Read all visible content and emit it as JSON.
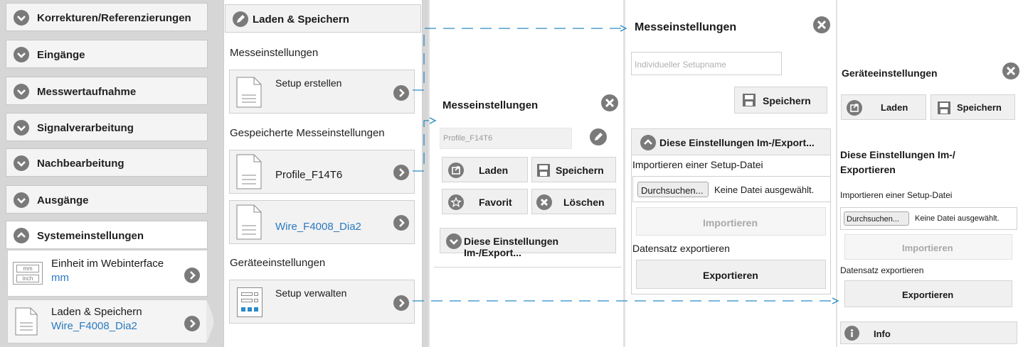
{
  "nav": {
    "items": [
      {
        "label": "Korrekturen/Referenzierungen"
      },
      {
        "label": "Eingänge"
      },
      {
        "label": "Messwertaufnahme"
      },
      {
        "label": "Signalverarbeitung"
      },
      {
        "label": "Nachbearbeitung"
      },
      {
        "label": "Ausgänge"
      },
      {
        "label": "Systemeinstellungen"
      }
    ],
    "unit_item": {
      "label": "Einheit im Webinterface",
      "value": "mm",
      "icon_top": "mm",
      "icon_bottom": "inch"
    },
    "save_item": {
      "label": "Laden & Speichern",
      "value": "Wire_F4008_Dia2"
    }
  },
  "panel2": {
    "title": "Laden & Speichern",
    "section1": "Messeinstellungen",
    "setup_create": "Setup erstellen",
    "section2": "Gespeicherte Messeinstellungen",
    "profile1": "Profile_F14T6",
    "profile2": "Wire_F4008_Dia2",
    "section3": "Geräteeinstellungen",
    "setup_manage": "Setup verwalten"
  },
  "panel3": {
    "title": "Messeinstellungen",
    "name_value": "Profile_F14T6",
    "load": "Laden",
    "save": "Speichern",
    "favorite": "Favorit",
    "delete": "Löschen",
    "export_header": "Diese Einstellungen Im-/Export..."
  },
  "panel4": {
    "title": "Messeinstellungen",
    "name_placeholder": "Individueller Setupname",
    "save": "Speichern",
    "export_header": "Diese Einstellungen Im-/Export...",
    "import_label": "Importieren einer Setup-Datei",
    "browse": "Durchsuchen...",
    "no_file": "Keine Datei ausgewählt.",
    "import_btn": "Importieren",
    "export_label": "Datensatz exportieren",
    "export_btn": "Exportieren"
  },
  "panel5": {
    "title": "Geräteeinstellungen",
    "load": "Laden",
    "save": "Speichern",
    "section": "Diese Einstellungen Im-/ Exportieren",
    "import_label": "Importieren einer Setup-Datei",
    "browse": "Durchsuchen...",
    "no_file": "Keine Datei ausgewählt.",
    "import_btn": "Importieren",
    "export_label": "Datensatz exportieren",
    "export_btn": "Exportieren",
    "info": "Info"
  },
  "colors": {
    "accent": "#2a7ac0",
    "icon_gray": "#7a7a7a",
    "panel_bg": "#d6d6d6",
    "arrow": "#2a8ac8"
  }
}
